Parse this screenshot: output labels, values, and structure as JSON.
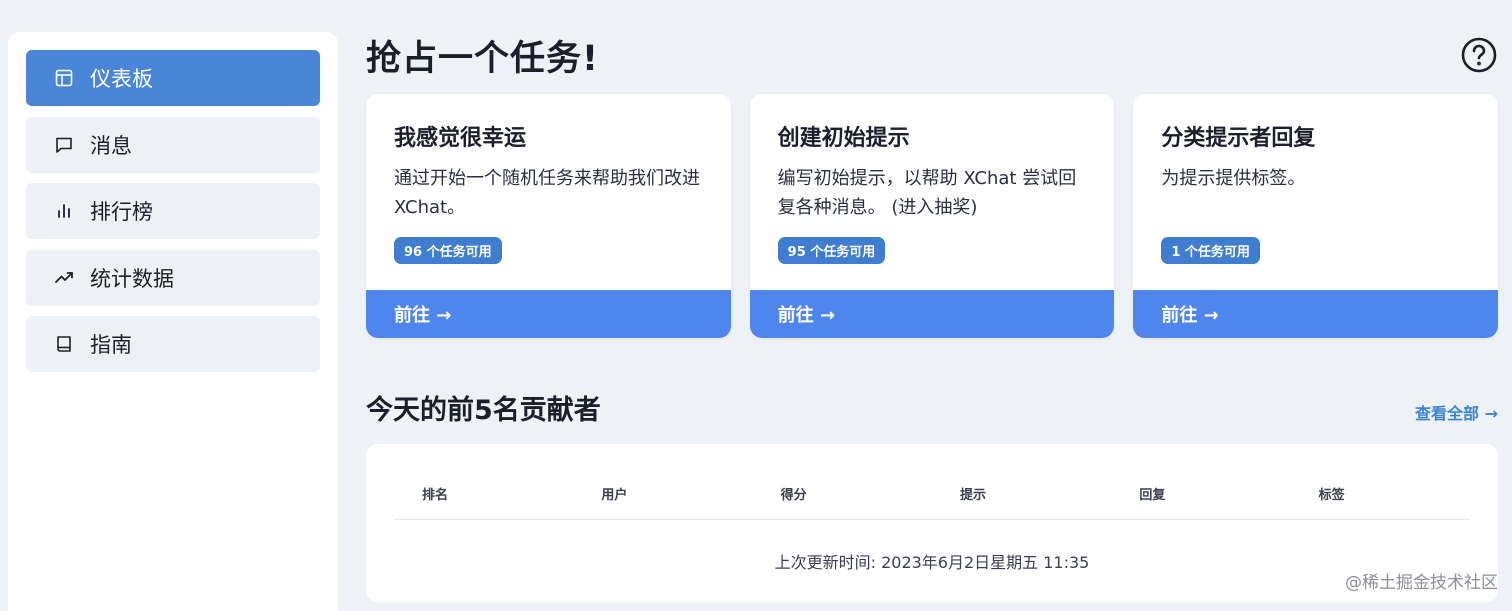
{
  "sidebar": {
    "items": [
      {
        "label": "仪表板",
        "icon": "dashboard-icon"
      },
      {
        "label": "消息",
        "icon": "message-icon"
      },
      {
        "label": "排行榜",
        "icon": "bar-chart-icon"
      },
      {
        "label": "统计数据",
        "icon": "trending-icon"
      },
      {
        "label": "指南",
        "icon": "book-icon"
      }
    ]
  },
  "main": {
    "title": "抢占一个任务!",
    "cards": [
      {
        "title": "我感觉很幸运",
        "desc": "通过开始一个随机任务来帮助我们改进 XChat。",
        "badge": "96 个任务可用",
        "action": "前往 →"
      },
      {
        "title": "创建初始提示",
        "desc": "编写初始提示，以帮助 XChat 尝试回复各种消息。 (进入抽奖)",
        "badge": "95 个任务可用",
        "action": "前往 →"
      },
      {
        "title": "分类提示者回复",
        "desc": "为提示提供标签。",
        "badge": "1 个任务可用",
        "action": "前往 →"
      }
    ],
    "contributors": {
      "title": "今天的前5名贡献者",
      "view_all": "查看全部 →",
      "columns": [
        "排名",
        "用户",
        "得分",
        "提示",
        "回复",
        "标签"
      ],
      "updated": "上次更新时间: 2023年6月2日星期五 11:35"
    }
  },
  "watermark": "@稀土掘金技术社区",
  "colors": {
    "accent": "#4a86d7",
    "footer_blue": "#4f86ee",
    "badge": "#3f7dd0",
    "link": "#3a84d3"
  }
}
